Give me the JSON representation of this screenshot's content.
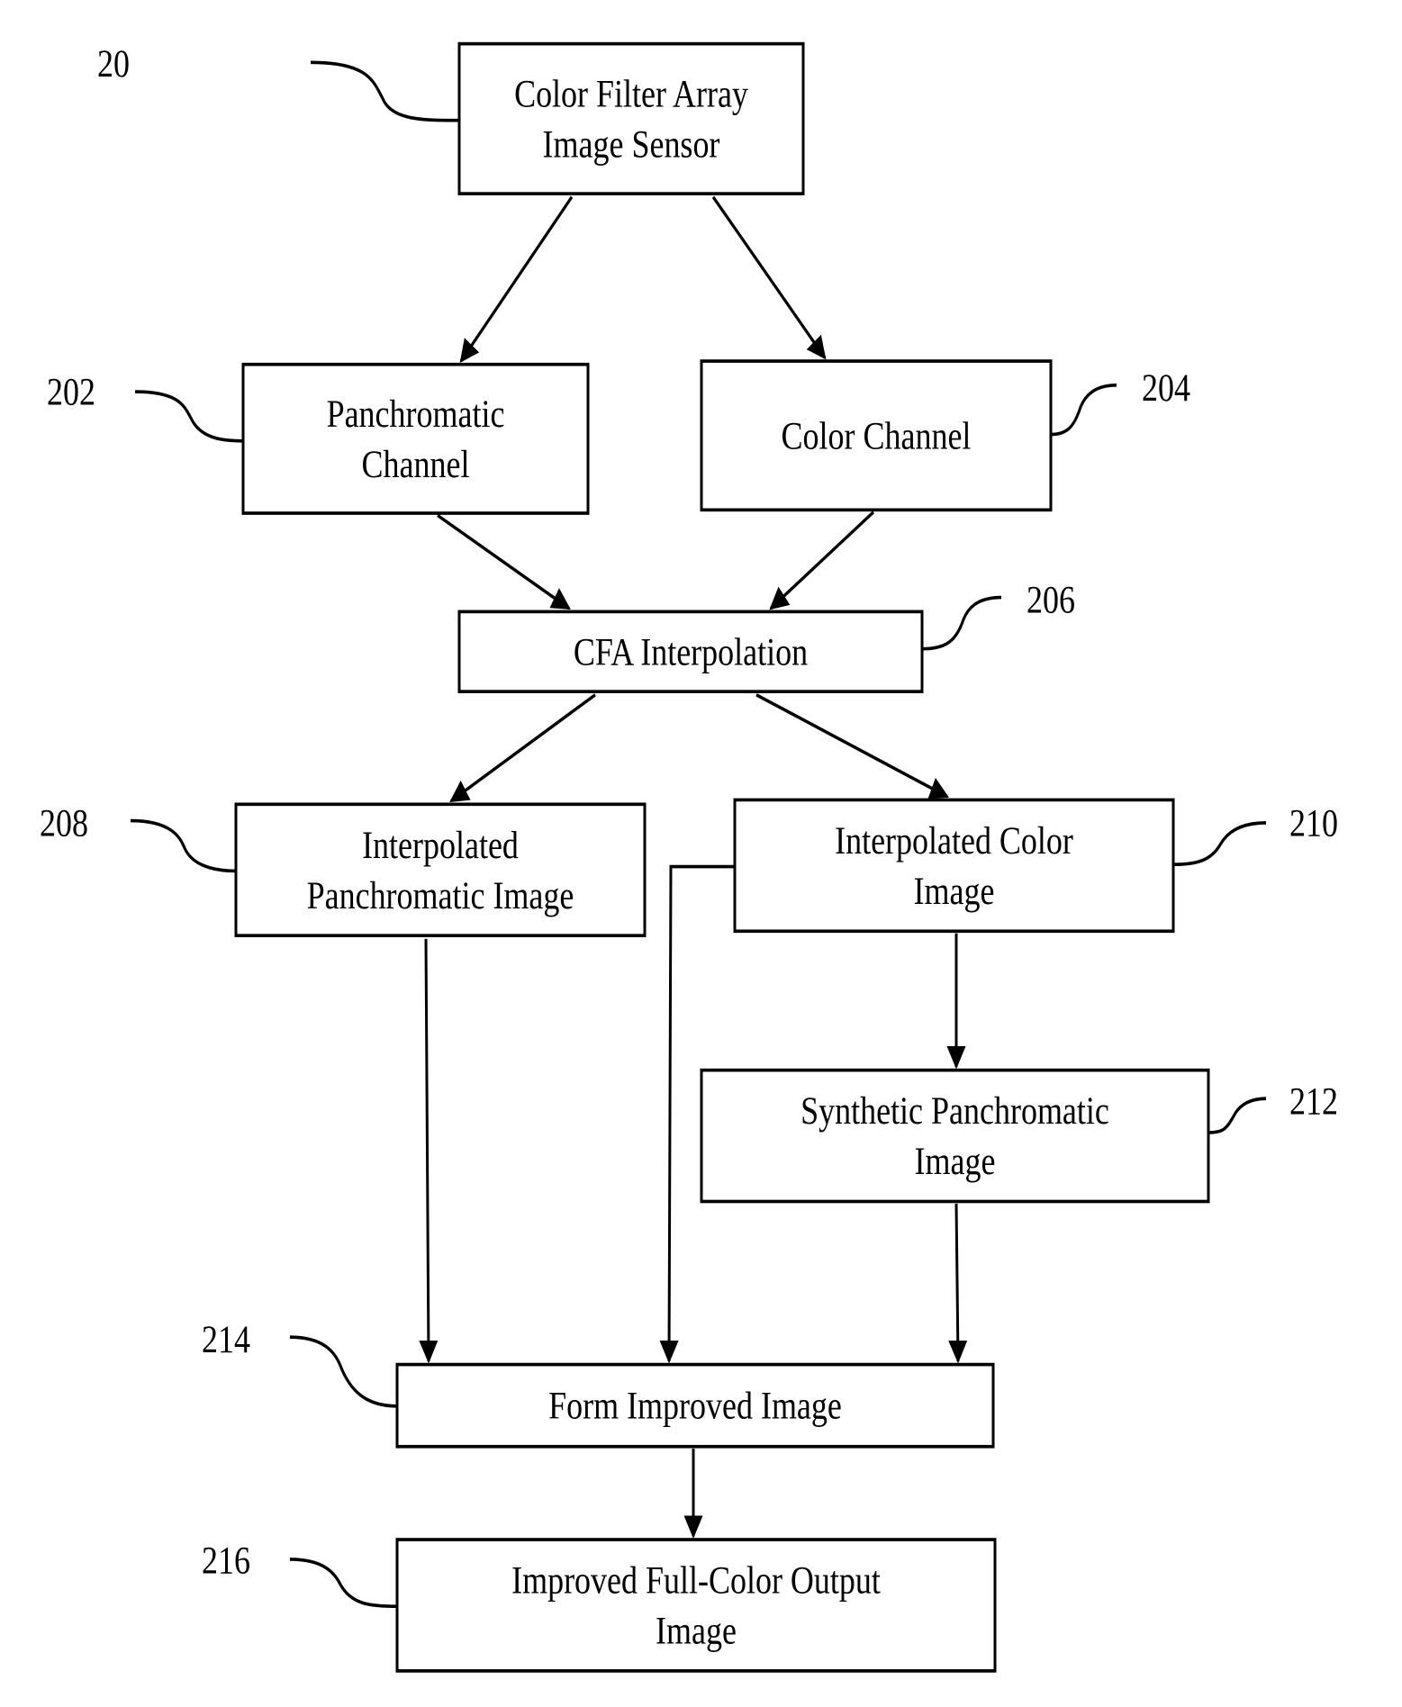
{
  "diagram": {
    "type": "flowchart",
    "nodes": [
      {
        "id": "20",
        "ref": "20",
        "lines": [
          "Color Filter Array",
          "Image Sensor"
        ]
      },
      {
        "id": "202",
        "ref": "202",
        "lines": [
          "Panchromatic",
          "Channel"
        ]
      },
      {
        "id": "204",
        "ref": "204",
        "lines": [
          "Color Channel"
        ]
      },
      {
        "id": "206",
        "ref": "206",
        "lines": [
          "CFA Interpolation"
        ]
      },
      {
        "id": "208",
        "ref": "208",
        "lines": [
          "Interpolated",
          "Panchromatic Image"
        ]
      },
      {
        "id": "210",
        "ref": "210",
        "lines": [
          "Interpolated Color",
          "Image"
        ]
      },
      {
        "id": "212",
        "ref": "212",
        "lines": [
          "Synthetic Panchromatic",
          "Image"
        ]
      },
      {
        "id": "214",
        "ref": "214",
        "lines": [
          "Form Improved Image"
        ]
      },
      {
        "id": "216",
        "ref": "216",
        "lines": [
          "Improved Full-Color Output",
          "Image"
        ]
      }
    ],
    "edges": [
      {
        "from": "20",
        "to": "202"
      },
      {
        "from": "20",
        "to": "204"
      },
      {
        "from": "202",
        "to": "206"
      },
      {
        "from": "204",
        "to": "206"
      },
      {
        "from": "206",
        "to": "208"
      },
      {
        "from": "206",
        "to": "210"
      },
      {
        "from": "208",
        "to": "214"
      },
      {
        "from": "210",
        "to": "214"
      },
      {
        "from": "210",
        "to": "212"
      },
      {
        "from": "212",
        "to": "214"
      },
      {
        "from": "214",
        "to": "216"
      }
    ]
  }
}
